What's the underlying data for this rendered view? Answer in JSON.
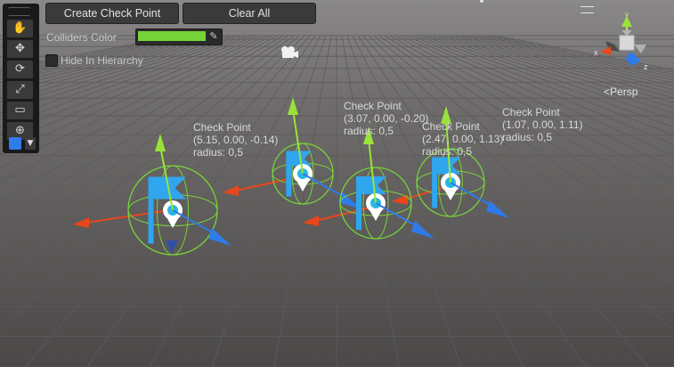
{
  "toolbar": {
    "tools": [
      "view-tool",
      "move-tool",
      "rotate-tool",
      "scale-tool",
      "rect-tool",
      "transform-tool"
    ]
  },
  "buttons": {
    "create_check_point": "Create Check Point",
    "clear_all": "Clear All"
  },
  "settings": {
    "colliders_color_label": "Colliders Color",
    "colliders_color": "#76d43a",
    "hide_in_hierarchy_label": "Hide In Hierarchy",
    "hide_in_hierarchy_checked": false
  },
  "scene_view": {
    "projection_label": "Persp",
    "gizmo_axes": {
      "x": "x",
      "y": "y",
      "z": "z"
    }
  },
  "check_points": [
    {
      "title": "Check Point",
      "position": "(5.15, 0.00, -0.14)",
      "radius": "radius: 0,5"
    },
    {
      "title": "Check Point",
      "position": "(3.07, 0.00, -0.20)",
      "radius": "radius: 0,5"
    },
    {
      "title": "Check Point",
      "position": "(2.47, 0.00, 1.13)",
      "radius": "radius: 0,5"
    },
    {
      "title": "Check Point",
      "position": "(1.07, 0.00, 1.11)",
      "radius": "radius: 0,5"
    }
  ],
  "colors": {
    "x_axis": "#e8461c",
    "y_axis": "#9ae23a",
    "z_axis": "#2f7bea",
    "flag": "#2fa6ee"
  }
}
